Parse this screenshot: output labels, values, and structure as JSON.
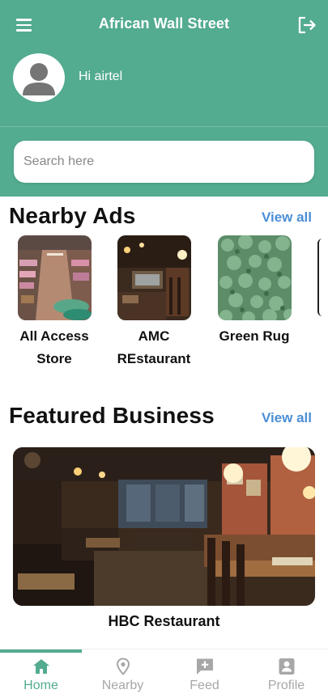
{
  "app": {
    "title": "African Wall Street",
    "accent_color": "#53ab90",
    "link_color": "#4a8ed6"
  },
  "header": {
    "menu_icon": "hamburger-menu-icon",
    "logout_icon": "logout-icon",
    "greeting": "Hi airtel",
    "avatar_icon": "user-avatar-icon"
  },
  "search": {
    "placeholder": "Search here",
    "value": ""
  },
  "nearby_ads": {
    "title": "Nearby Ads",
    "view_all": "View all",
    "items": [
      {
        "label": "All Access Store",
        "image": "store-shelves-photo"
      },
      {
        "label": "AMC REstaurant",
        "image": "restaurant-interior-photo"
      },
      {
        "label": "Green Rug",
        "image": "green-rug-photo"
      }
    ]
  },
  "featured_business": {
    "title": "Featured Business",
    "view_all": "View all",
    "item": {
      "name": "HBC Restaurant",
      "image": "restaurant-dining-hall-photo"
    }
  },
  "bottom_nav": {
    "active": "Home",
    "items": [
      {
        "label": "Home",
        "icon": "home-icon"
      },
      {
        "label": "Nearby",
        "icon": "location-pin-icon"
      },
      {
        "label": "Feed",
        "icon": "feed-add-icon"
      },
      {
        "label": "Profile",
        "icon": "profile-icon"
      }
    ]
  }
}
